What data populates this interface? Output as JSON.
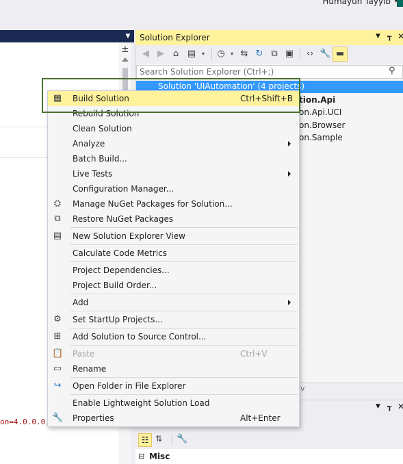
{
  "header": {
    "user_name": "Humayun Tayyib",
    "user_chevron": "▾"
  },
  "editor": {
    "code_fragment": "on=4.0.0.0,"
  },
  "solution_explorer": {
    "title": "Solution Explorer",
    "search_placeholder": "Search Solution Explorer (Ctrl+;)",
    "tree": {
      "solution": "Solution 'UIAutomation' (4 projects)",
      "items": [
        "tion.Api",
        "on.Api.UCI",
        "on.Browser",
        "on.Sample"
      ]
    },
    "tab_fragment": "v"
  },
  "properties": {
    "category": "Misc"
  },
  "context_menu": {
    "items": [
      {
        "label": "Build Solution",
        "shortcut": "Ctrl+Shift+B",
        "icon": "build-icon"
      },
      {
        "label": "Rebuild Solution"
      },
      {
        "label": "Clean Solution"
      },
      {
        "label": "Analyze",
        "submenu": true
      },
      {
        "label": "Batch Build..."
      },
      {
        "label": "Live Tests",
        "submenu": true
      },
      {
        "label": "Configuration Manager..."
      },
      {
        "label": "Manage NuGet Packages for Solution...",
        "icon": "nuget-icon"
      },
      {
        "label": "Restore NuGet Packages",
        "icon": "restore-icon"
      },
      {
        "label": "New Solution Explorer View",
        "icon": "new-view-icon"
      },
      {
        "label": "Calculate Code Metrics"
      },
      {
        "label": "Project Dependencies..."
      },
      {
        "label": "Project Build Order..."
      },
      {
        "label": "Add",
        "submenu": true
      },
      {
        "label": "Set StartUp Projects...",
        "icon": "gear-icon"
      },
      {
        "label": "Add Solution to Source Control...",
        "icon": "source-control-icon"
      },
      {
        "label": "Paste",
        "shortcut": "Ctrl+V",
        "disabled": true,
        "icon": "paste-icon"
      },
      {
        "label": "Rename",
        "icon": "rename-icon"
      },
      {
        "label": "Open Folder in File Explorer",
        "icon": "open-folder-icon"
      },
      {
        "label": "Enable Lightweight Solution Load"
      },
      {
        "label": "Properties",
        "shortcut": "Alt+Enter",
        "icon": "wrench-icon"
      }
    ]
  }
}
